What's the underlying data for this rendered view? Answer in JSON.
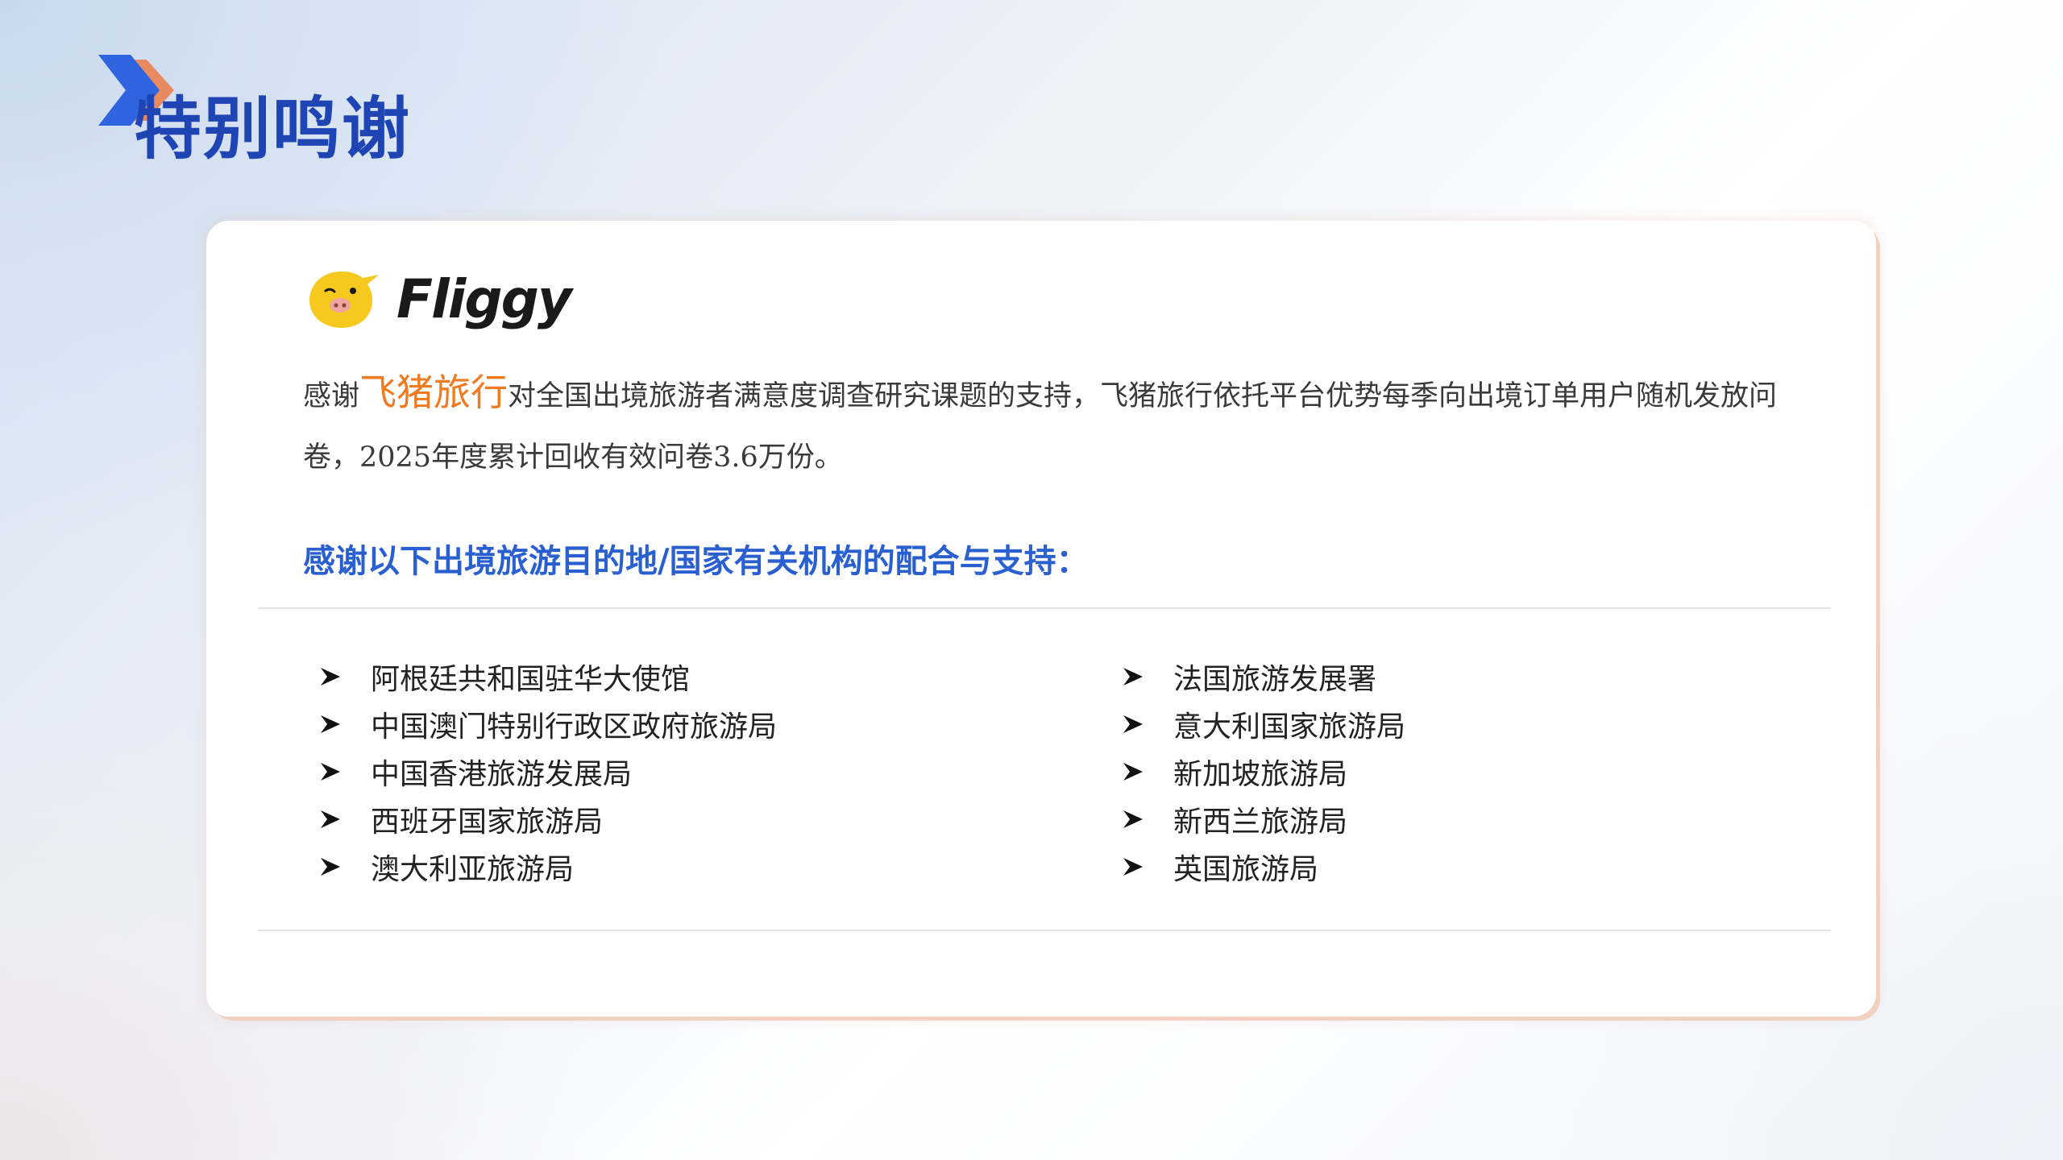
{
  "page": {
    "title": "特别鸣谢"
  },
  "logo": {
    "text": "Fliggy",
    "icon": "fliggy-pig-icon"
  },
  "intro": {
    "prefix": "感谢",
    "brand": "飞猪旅行",
    "body": "对全国出境旅游者满意度调查研究课题的支持，飞猪旅行依托平台优势每季向出境订单用户随机发放问卷，2025年度累计回收有效问卷3.6万份。"
  },
  "subheading": "感谢以下出境旅游目的地/国家有关机构的配合与支持：",
  "organizations": {
    "left": [
      "阿根廷共和国驻华大使馆",
      "中国澳门特别行政区政府旅游局",
      "中国香港旅游发展局",
      "西班牙国家旅游局",
      "澳大利亚旅游局"
    ],
    "right": [
      "法国旅游发展署",
      "意大利国家旅游局",
      "新加坡旅游局",
      "新西兰旅游局",
      "英国旅游局"
    ]
  },
  "colors": {
    "title": "#1f44b4",
    "brand": "#f07a22",
    "subheading": "#2a5fd0",
    "chevron_blue": "#2f64e0",
    "chevron_orange": "#e8855a",
    "logo_yellow": "#f7c81e"
  },
  "icons": {
    "bullet": "arrow-bullet-icon",
    "title_decoration": "chevron-icon"
  }
}
